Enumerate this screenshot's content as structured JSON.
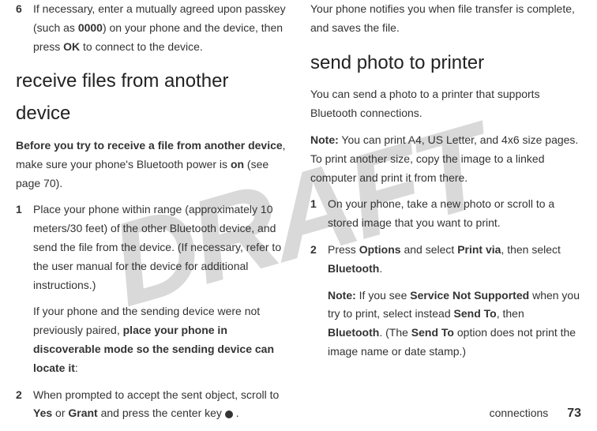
{
  "watermark": "DRAFT",
  "left": {
    "item6": {
      "num": "6",
      "text_a": "If necessary, enter a mutually agreed upon passkey (such as ",
      "code_a": "0000",
      "text_b": ") on your phone and the device, then press ",
      "code_b": "OK",
      "text_c": " to connect to the device."
    },
    "heading1": "receive files from another device",
    "para1_a": "Before you try to receive a file from another device",
    "para1_b": ", make sure your phone's Bluetooth power is ",
    "para1_bold": "on",
    "para1_c": " (see page 70).",
    "item1": {
      "num": "1",
      "text": "Place your phone within range (approximately 10 meters/30 feet) of the other Bluetooth device, and send the file from the device. (If necessary, refer to the user manual for the device for additional instructions.)"
    },
    "note1_a": "If your phone and the sending device were not previously paired, ",
    "note1_bold": "place your phone in discoverable mode so the sending device can locate it",
    "note1_b": ":",
    "item2": {
      "num": "2",
      "text_a": "When prompted to accept the sent object, scroll to ",
      "code_a": "Yes",
      "text_b": " or ",
      "code_b": "Grant",
      "text_c": " and press the center key ",
      "text_d": " ."
    }
  },
  "right": {
    "para_top": "Your phone notifies you when file transfer is complete, and saves the file.",
    "heading2": "send photo to printer",
    "para2": "You can send a photo to a printer that supports Bluetooth connections.",
    "note_label": "Note:",
    "note_text": " You can print A4, US Letter, and 4x6 size pages. To print another size, copy the image to a linked computer and print it from there.",
    "item1": {
      "num": "1",
      "text": "On your phone, take a new photo or scroll to a stored image that you want to print."
    },
    "item2": {
      "num": "2",
      "text_a": "Press ",
      "code_a": "Options",
      "text_b": " and select ",
      "code_b": "Print via",
      "text_c": ", then select ",
      "code_c": "Bluetooth",
      "text_d": "."
    },
    "note2_label": "Note:",
    "note2_a": " If you see ",
    "note2_code_a": "Service Not Supported",
    "note2_b": " when you try to print, select instead ",
    "note2_code_b": "Send To",
    "note2_c": ", then ",
    "note2_code_c": "Bluetooth",
    "note2_d": ". (The ",
    "note2_code_d": "Send To",
    "note2_e": " option does not print the image name or date stamp.)"
  },
  "footer": {
    "section": "connections",
    "page": "73"
  }
}
